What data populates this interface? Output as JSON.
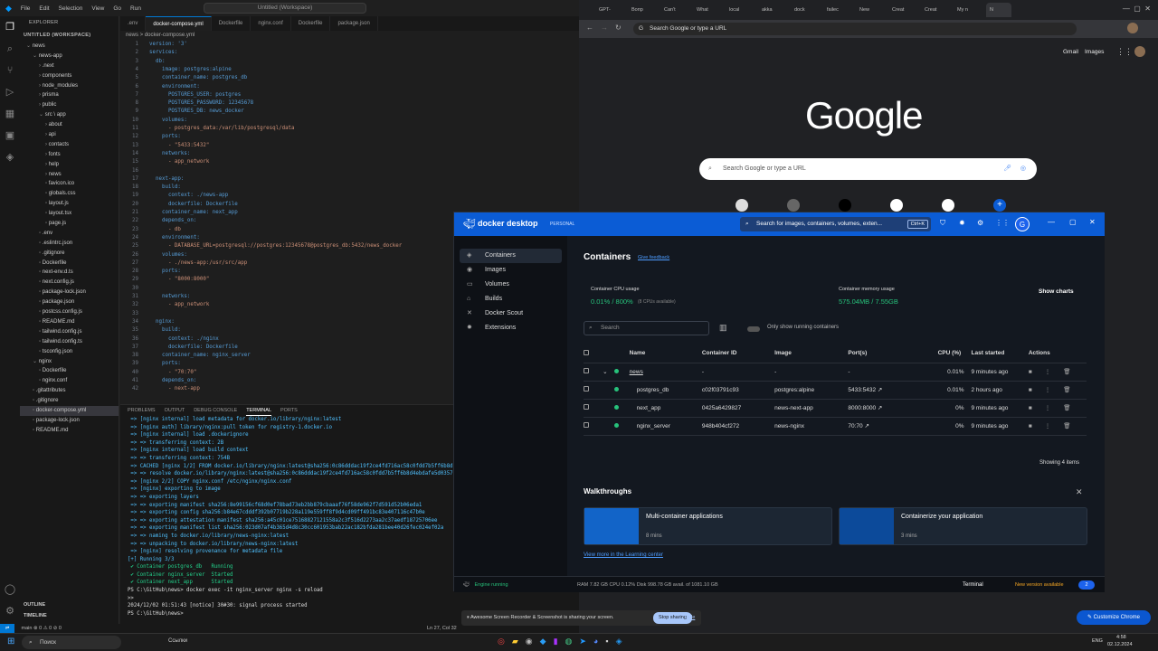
{
  "vscode": {
    "menu": [
      "File",
      "Edit",
      "Selection",
      "View",
      "Go",
      "Run"
    ],
    "title_search": "Untitled (Workspace)",
    "explorer_header": "EXPLORER",
    "workspace": "UNTITLED (WORKSPACE)",
    "tree": [
      {
        "label": "news",
        "indent": 1,
        "type": "folder-open"
      },
      {
        "label": "news-app",
        "indent": 2,
        "type": "folder-open"
      },
      {
        "label": ".next",
        "indent": 3,
        "type": "folder"
      },
      {
        "label": "components",
        "indent": 3,
        "type": "folder"
      },
      {
        "label": "node_modules",
        "indent": 3,
        "type": "folder"
      },
      {
        "label": "prisma",
        "indent": 3,
        "type": "folder"
      },
      {
        "label": "public",
        "indent": 3,
        "type": "folder"
      },
      {
        "label": "src \\ app",
        "indent": 3,
        "type": "folder-open"
      },
      {
        "label": "about",
        "indent": 4,
        "type": "folder"
      },
      {
        "label": "api",
        "indent": 4,
        "type": "folder"
      },
      {
        "label": "contacts",
        "indent": 4,
        "type": "folder"
      },
      {
        "label": "fonts",
        "indent": 4,
        "type": "folder"
      },
      {
        "label": "help",
        "indent": 4,
        "type": "folder"
      },
      {
        "label": "news",
        "indent": 4,
        "type": "folder"
      },
      {
        "label": "favicon.ico",
        "indent": 4,
        "type": "file"
      },
      {
        "label": "globals.css",
        "indent": 4,
        "type": "file"
      },
      {
        "label": "layout.js",
        "indent": 4,
        "type": "file"
      },
      {
        "label": "layout.tsx",
        "indent": 4,
        "type": "file"
      },
      {
        "label": "page.js",
        "indent": 4,
        "type": "file"
      },
      {
        "label": ".env",
        "indent": 3,
        "type": "file"
      },
      {
        "label": ".eslintrc.json",
        "indent": 3,
        "type": "file"
      },
      {
        "label": ".gitignore",
        "indent": 3,
        "type": "file"
      },
      {
        "label": "Dockerfile",
        "indent": 3,
        "type": "file"
      },
      {
        "label": "next-env.d.ts",
        "indent": 3,
        "type": "file"
      },
      {
        "label": "next.config.js",
        "indent": 3,
        "type": "file"
      },
      {
        "label": "package-lock.json",
        "indent": 3,
        "type": "file"
      },
      {
        "label": "package.json",
        "indent": 3,
        "type": "file"
      },
      {
        "label": "postcss.config.js",
        "indent": 3,
        "type": "file"
      },
      {
        "label": "README.md",
        "indent": 3,
        "type": "file"
      },
      {
        "label": "tailwind.config.js",
        "indent": 3,
        "type": "file"
      },
      {
        "label": "tailwind.config.ts",
        "indent": 3,
        "type": "file"
      },
      {
        "label": "tsconfig.json",
        "indent": 3,
        "type": "file"
      },
      {
        "label": "nginx",
        "indent": 2,
        "type": "folder-open"
      },
      {
        "label": "Dockerfile",
        "indent": 3,
        "type": "file"
      },
      {
        "label": "nginx.conf",
        "indent": 3,
        "type": "file"
      },
      {
        "label": ".gitattributes",
        "indent": 2,
        "type": "file"
      },
      {
        "label": ".gitignore",
        "indent": 2,
        "type": "file"
      },
      {
        "label": "docker-compose.yml",
        "indent": 2,
        "type": "file",
        "selected": true
      },
      {
        "label": "package-lock.json",
        "indent": 2,
        "type": "file"
      },
      {
        "label": "README.md",
        "indent": 2,
        "type": "file"
      }
    ],
    "outline": "OUTLINE",
    "timeline": "TIMELINE",
    "tabs": [
      {
        "label": ".env",
        "active": false
      },
      {
        "label": "docker-compose.yml",
        "active": true
      },
      {
        "label": "Dockerfile",
        "active": false
      },
      {
        "label": "nginx.conf",
        "active": false
      },
      {
        "label": "Dockerfile",
        "active": false
      },
      {
        "label": "package.json",
        "active": false
      }
    ],
    "breadcrumb": "news > docker-compose.yml",
    "code": [
      "version: '3'",
      "services:",
      "  db:",
      "    image: postgres:alpine",
      "    container_name: postgres_db",
      "    environment:",
      "      POSTGRES_USER: postgres",
      "      POSTGRES_PASSWORD: 12345678",
      "      POSTGRES_DB: news_docker",
      "    volumes:",
      "      - postgres_data:/var/lib/postgresql/data",
      "    ports:",
      "      - \"5433:5432\"",
      "    networks:",
      "      - app_network",
      "",
      "  next-app:",
      "    build:",
      "      context: ./news-app",
      "      dockerfile: Dockerfile",
      "    container_name: next_app",
      "    depends_on:",
      "      - db",
      "    environment:",
      "      - DATABASE_URL=postgresql://postgres:12345678@postgres_db:5432/news_docker",
      "    volumes:",
      "      - ./news-app:/usr/src/app",
      "    ports:",
      "      - \"8000:8000\"",
      "",
      "    networks:",
      "      - app_network",
      "",
      "  nginx:",
      "    build:",
      "      context: ./nginx",
      "      dockerfile: Dockerfile",
      "    container_name: nginx_server",
      "    ports:",
      "      - \"70:70\"",
      "    depends_on:",
      "      - next-app"
    ],
    "panel_tabs": [
      "PROBLEMS",
      "OUTPUT",
      "DEBUG CONSOLE",
      "TERMINAL",
      "PORTS"
    ],
    "terminal": [
      {
        "t": " => [nginx internal] load metadata for docker.io/library/nginx:latest",
        "c": "b"
      },
      {
        "t": " => [nginx auth] library/nginx:pull token for registry-1.docker.io",
        "c": "b"
      },
      {
        "t": " => [nginx internal] load .dockerignore",
        "c": "b"
      },
      {
        "t": " => => transferring context: 2B",
        "c": "b"
      },
      {
        "t": " => [nginx internal] load build context",
        "c": "b"
      },
      {
        "t": " => => transferring context: 754B",
        "c": "b"
      },
      {
        "t": " => CACHED [nginx 1/2] FROM docker.io/library/nginx:latest@sha256:0c86dddac19f2ce4fd716ac58c0fdd7b5ff6b8d",
        "c": "b"
      },
      {
        "t": " => => resolve docker.io/library/nginx:latest@sha256:0c86dddac19f2ce4fd716ac58c0fdd7b5ff6b8d4ebdafe5d0357",
        "c": "b"
      },
      {
        "t": " => [nginx 2/2] COPY nginx.conf /etc/nginx/nginx.conf",
        "c": "b"
      },
      {
        "t": " => [nginx] exporting to image",
        "c": "b"
      },
      {
        "t": " => => exporting layers",
        "c": "b"
      },
      {
        "t": " => => exporting manifest sha256:8e99156cf68d0ef78bad73eb2bb879cbaaaf76f58de962f7d591d52b06eda1",
        "c": "b"
      },
      {
        "t": " => => exporting config sha256:b84e67cdddf392b07719b228a119e559ff8f9d4cd09ff491bc83e407116c47b0e",
        "c": "b"
      },
      {
        "t": " => => exporting attestation manifest sha256:a45c01ce75168827121558a2c3f516d2273aa2c37aedf18725706ee",
        "c": "b"
      },
      {
        "t": " => => exporting manifest list sha256:023d07af4b365d4d8c30cc601953bab22ac182bfda281bee40d26fec024ef02a",
        "c": "b"
      },
      {
        "t": " => => naming to docker.io/library/news-nginx:latest",
        "c": "b"
      },
      {
        "t": " => => unpacking to docker.io/library/news-nginx:latest",
        "c": "b"
      },
      {
        "t": " => [nginx] resolving provenance for metadata file",
        "c": "b"
      },
      {
        "t": "[+] Running 3/3",
        "c": "b"
      },
      {
        "t": " ✔ Container postgres_db   Running",
        "c": "g"
      },
      {
        "t": " ✔ Container nginx_server  Started",
        "c": "g"
      },
      {
        "t": " ✔ Container next_app      Started",
        "c": "g"
      },
      {
        "t": "PS C:\\GitHub\\news> docker exec -it nginx_server nginx -s reload",
        "c": "w"
      },
      {
        "t": ">>",
        "c": "w"
      },
      {
        "t": "2024/12/02 01:51:43 [notice] 30#30: signal process started",
        "c": "w"
      },
      {
        "t": "PS C:\\GitHub\\news> ",
        "c": "w"
      }
    ],
    "status_left": "main  ⊗ 0 ⚠ 0   ⊘ 0",
    "status_right": "Ln 27, Col 32"
  },
  "chrome": {
    "tabs": [
      "GPT-",
      "Вопр",
      "Can't",
      "What",
      "local",
      "akka",
      "dock",
      "failec",
      "New",
      "Creat",
      "Creat",
      "My n",
      "N"
    ],
    "omnibox": "Search Google or type a URL",
    "links": [
      "Gmail",
      "Images"
    ],
    "logo": "Google",
    "search_placeholder": "Search Google or type a URL",
    "customize": "Customize Chrome"
  },
  "docker": {
    "brand": "docker desktop",
    "edition": "PERSONAL",
    "search": "Search for images, containers, volumes, exten...",
    "shortcut": "Ctrl+K",
    "avatar": "G",
    "nav": [
      "Containers",
      "Images",
      "Volumes",
      "Builds",
      "Docker Scout",
      "Extensions"
    ],
    "heading": "Containers",
    "feedback": "Give feedback",
    "cpu_label": "Container CPU usage",
    "cpu_value": "0.01% / 800%",
    "cpu_note": "(8 CPUs available)",
    "mem_label": "Container memory usage",
    "mem_value": "575.04MB / 7.55GB",
    "show_charts": "Show charts",
    "search_placeholder": "Search",
    "only_running": "Only show running containers",
    "columns": [
      "Name",
      "Container ID",
      "Image",
      "Port(s)",
      "CPU (%)",
      "Last started",
      "Actions"
    ],
    "rows": [
      {
        "name": "news",
        "id": "-",
        "image": "-",
        "ports": "-",
        "cpu": "0.01%",
        "last": "9 minutes ago",
        "group": true
      },
      {
        "name": "postgres_db",
        "id": "c02f03791c93",
        "image": "postgres:alpine",
        "ports": "5433:5432",
        "cpu": "0.01%",
        "last": "2 hours ago"
      },
      {
        "name": "next_app",
        "id": "0425a6429827",
        "image": "news-next-app",
        "ports": "8000:8000",
        "cpu": "0%",
        "last": "9 minutes ago"
      },
      {
        "name": "nginx_server",
        "id": "948b404cf272",
        "image": "news-nginx",
        "ports": "70:70",
        "cpu": "0%",
        "last": "9 minutes ago"
      }
    ],
    "showing": "Showing 4 items",
    "walk_title": "Walkthroughs",
    "walk1": "Multi-container applications",
    "walk1_time": "8 mins",
    "walk2": "Containerize your application",
    "walk2_time": "3 mins",
    "learn_more": "View more in the Learning center",
    "engine": "Engine running",
    "footer_stats": "RAM 7.82 GB  CPU 0.12%   Disk 998.78 GB avail. of 1081.10 GB",
    "terminal": "Terminal",
    "new_version": "New version available",
    "badge": "2"
  },
  "share_bar": {
    "text": "Awesome Screen Recorder & Screenshot is sharing your screen.",
    "stop": "Stop sharing",
    "hide": "Hide"
  },
  "taskbar": {
    "search": "Поиск",
    "widget": "Ссылки",
    "lang": "ENG",
    "time": "4:58",
    "date": "02.12.2024"
  }
}
